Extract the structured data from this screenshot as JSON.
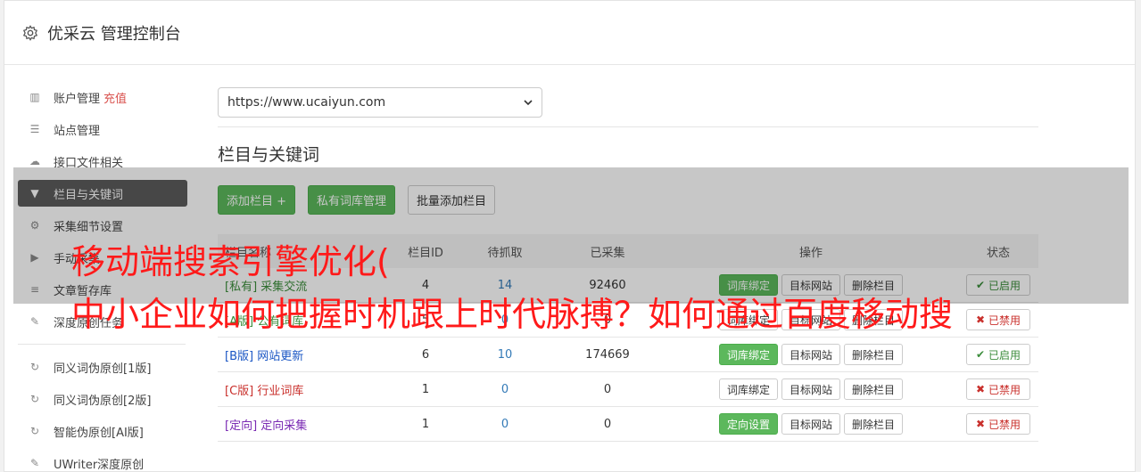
{
  "header": {
    "title": "优采云 管理控制台",
    "icon": "gear-icon"
  },
  "sidebar": {
    "group1": [
      {
        "label": "账户管理",
        "extra": "充值",
        "icon": "bar-chart-icon"
      },
      {
        "label": "站点管理",
        "icon": "server-icon"
      },
      {
        "label": "接口文件相关",
        "icon": "cloud-upload-icon"
      },
      {
        "label": "栏目与关键词",
        "icon": "filter-icon",
        "active": true
      },
      {
        "label": "采集细节设置",
        "icon": "cogs-icon"
      },
      {
        "label": "手动采集",
        "icon": "play-circle-icon"
      },
      {
        "label": "文章暂存库",
        "icon": "database-icon"
      },
      {
        "label": "深度原创任务",
        "icon": "edit-icon"
      }
    ],
    "group2": [
      {
        "label": "同义词伪原创[1版]",
        "icon": "refresh-icon"
      },
      {
        "label": "同义词伪原创[2版]",
        "icon": "refresh-icon"
      },
      {
        "label": "智能伪原创[AI版]",
        "icon": "refresh-icon"
      },
      {
        "label": "UWriter深度原创",
        "icon": "edit-icon"
      }
    ]
  },
  "main": {
    "site_select": "https://www.ucaiyun.com",
    "section_title": "栏目与关键词",
    "toolbar": {
      "add": "添加栏目 +",
      "private_lib": "私有词库管理",
      "bulk_add": "批量添加栏目"
    },
    "table": {
      "headers": [
        "栏目名称",
        "栏目ID",
        "待抓取",
        "已采集",
        "操作",
        "状态"
      ],
      "rows": [
        {
          "tag": "[私有]",
          "name": "采集交流",
          "id": "4",
          "pending": "14",
          "collected": "92460",
          "action1": "词库绑定",
          "action1_green": true,
          "action2": "目标网站",
          "action3": "删除栏目",
          "status": "已启用",
          "on": true
        },
        {
          "tag": "[A版]",
          "name": "公有词库",
          "id": "5",
          "pending": "0",
          "collected": "0",
          "action1": "词库绑定",
          "action1_green": false,
          "action2": "目标网站",
          "action3": "删除栏目",
          "status": "已禁用",
          "on": false
        },
        {
          "tag": "[B版]",
          "name": "网站更新",
          "id": "6",
          "pending": "10",
          "collected": "174669",
          "action1": "词库绑定",
          "action1_green": true,
          "action2": "目标网站",
          "action3": "删除栏目",
          "status": "已启用",
          "on": true
        },
        {
          "tag": "[C版]",
          "name": "行业词库",
          "id": "1",
          "pending": "0",
          "collected": "0",
          "action1": "词库绑定",
          "action1_green": false,
          "action2": "目标网站",
          "action3": "删除栏目",
          "status": "已禁用",
          "on": false
        },
        {
          "tag": "[定向]",
          "name": "定向采集",
          "id": "1",
          "pending": "0",
          "collected": "0",
          "action1": "定向设置",
          "action1_green": true,
          "action2": "目标网站",
          "action3": "删除栏目",
          "status": "已禁用",
          "on": false
        }
      ]
    }
  },
  "overlay": {
    "line1": "移动端搜索引擎优化(",
    "line2": "中小企业如何把握时机跟上时代脉搏？如何通过百度移动搜"
  }
}
